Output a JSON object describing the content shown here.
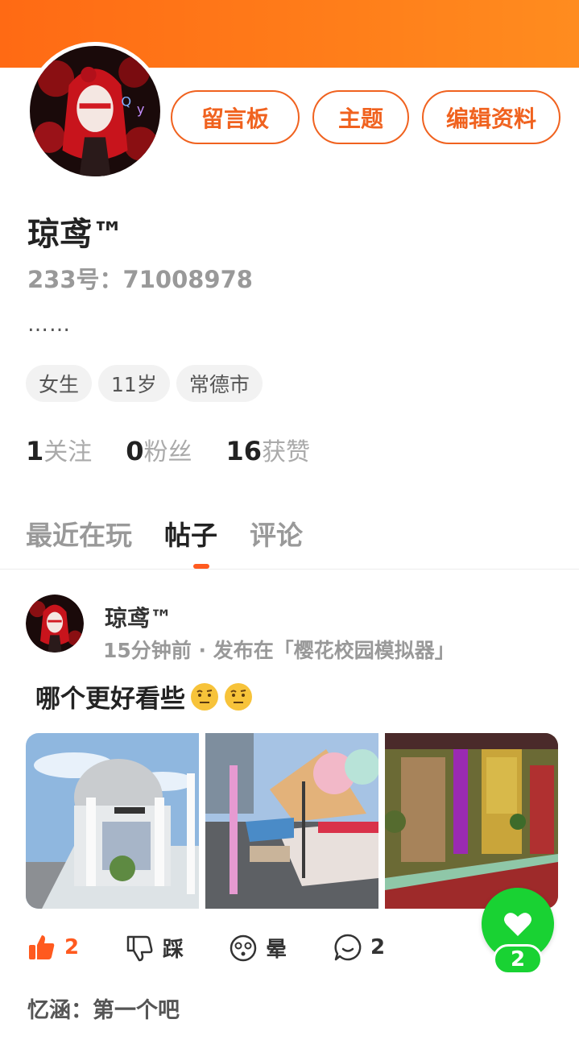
{
  "header": {
    "accent_color": "#ff6a14",
    "buttons": {
      "board": "留言板",
      "theme": "主题",
      "edit": "编辑资料"
    }
  },
  "profile": {
    "username": "琼鸢™",
    "id_line": "233号：71008978",
    "bio": "……",
    "tags": [
      "女生",
      "11岁",
      "常德市"
    ],
    "stats": [
      {
        "value": "1",
        "label": "关注"
      },
      {
        "value": "0",
        "label": "粉丝"
      },
      {
        "value": "16",
        "label": "获赞"
      }
    ]
  },
  "tabs": [
    {
      "label": "最近在玩",
      "active": false
    },
    {
      "label": "帖子",
      "active": true
    },
    {
      "label": "评论",
      "active": false
    }
  ],
  "post": {
    "author": "琼鸢™",
    "meta": "15分钟前 · 发布在「樱花校园模拟器」",
    "text": "哪个更好看些",
    "emojis": [
      "raised-eyebrow-emoji",
      "raised-eyebrow-emoji"
    ],
    "images": [
      "school-building-scene",
      "ice-cream-shop-scene",
      "interior-hallway-scene"
    ],
    "actions": {
      "like_count": "2",
      "dislike_label": "踩",
      "dizzy_label": "晕",
      "comment_count": "2"
    },
    "top_comment": "忆涵：第一个吧"
  },
  "floating": {
    "like_count": "2",
    "color": "#19d233"
  }
}
